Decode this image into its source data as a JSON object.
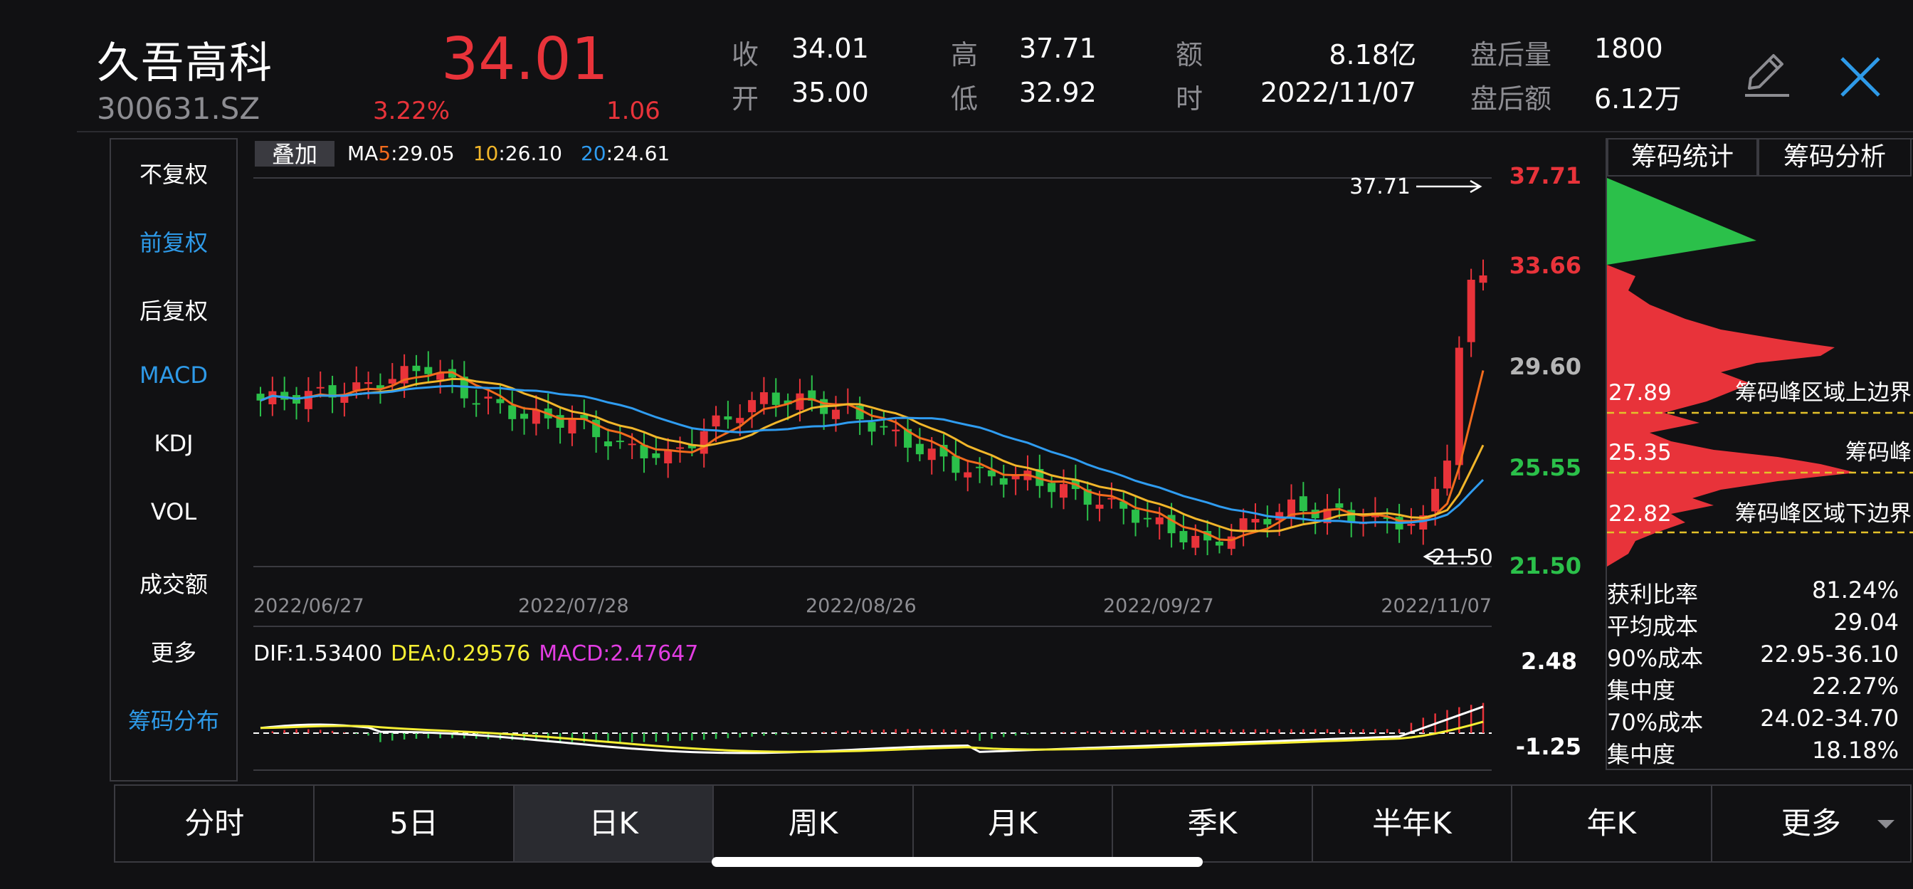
{
  "stock": {
    "name": "久吾高科",
    "code": "300631.SZ",
    "price": "34.01",
    "change_pct": "3.22%",
    "change_amt": "1.06"
  },
  "quote": {
    "close_label": "收",
    "close": "34.01",
    "open_label": "开",
    "open": "35.00",
    "high_label": "高",
    "high": "37.71",
    "low_label": "低",
    "low": "32.92",
    "amount_label": "额",
    "amount": "8.18亿",
    "time_label": "时",
    "date": "2022/11/07",
    "after_vol_label": "盘后量",
    "after_vol": "1800",
    "after_amt_label": "盘后额",
    "after_amt": "6.12万"
  },
  "side_menu": [
    "不复权",
    "前复权",
    "后复权",
    "MACD",
    "KDJ",
    "VOL",
    "成交额",
    "更多",
    "筹码分布"
  ],
  "side_menu_active": [
    "前复权",
    "MACD",
    "筹码分布"
  ],
  "overlay_button": "叠加",
  "ma": {
    "ma5_prefix": "MA",
    "ma5_n": "5",
    "ma5": ":29.05",
    "ma10_n": "10",
    "ma10": ":26.10",
    "ma20_n": "20",
    "ma20": ":24.61"
  },
  "macd": {
    "dif": "DIF:1.53400",
    "dea": "DEA:0.29576",
    "macd": "MACD:2.47647"
  },
  "chart_data": {
    "type": "candlestick",
    "x_ticks": [
      "2022/06/27",
      "2022/07/28",
      "2022/08/26",
      "2022/09/27",
      "2022/11/07"
    ],
    "y_ticks": [
      "37.71",
      "33.66",
      "29.60",
      "25.55",
      "21.50"
    ],
    "ylim": [
      21.5,
      37.71
    ],
    "max_annotation": "37.71",
    "min_annotation": "21.50",
    "macd_ticks": [
      "2.48",
      "-1.25"
    ],
    "tick_colors": [
      "#e8333a",
      "#e8333a",
      "#b5b5b5",
      "#2bc04a",
      "#2bc04a"
    ],
    "ma_colors": {
      "ma5": "#f26b1d",
      "ma10": "#f2b62a",
      "ma20": "#2f9cf0"
    },
    "up_color": "#e8333a",
    "down_color": "#2bc04a",
    "dif_color": "#ffffff",
    "dea_color": "#f6ef33",
    "macd_color": "#e23de2"
  },
  "chip_tabs": [
    "筹码统计",
    "筹码分析"
  ],
  "chip_levels": [
    {
      "price": "27.89",
      "label": "筹码峰区域上边界"
    },
    {
      "price": "25.35",
      "label": "筹码峰"
    },
    {
      "price": "22.82",
      "label": "筹码峰区域下边界"
    }
  ],
  "chip_stats": [
    {
      "label": "获利比率",
      "value": "81.24%"
    },
    {
      "label": "平均成本",
      "value": "29.04"
    },
    {
      "label": "90%成本",
      "value": "22.95-36.10"
    },
    {
      "label": "集中度",
      "value": "22.27%"
    },
    {
      "label": "70%成本",
      "value": "24.02-34.70"
    },
    {
      "label": "集中度",
      "value": "18.18%"
    }
  ],
  "period_tabs": [
    "分时",
    "5日",
    "日K",
    "周K",
    "月K",
    "季K",
    "半年K",
    "年K",
    "更多"
  ],
  "period_active": "日K",
  "icons": {
    "edit": "pencil-icon",
    "close": "close-icon",
    "dropdown": "triangle-down-icon"
  }
}
